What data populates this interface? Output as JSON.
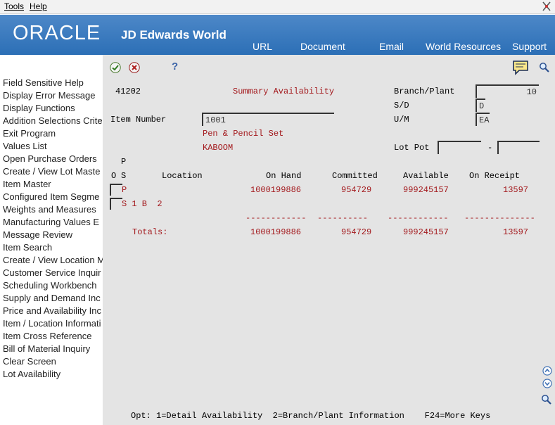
{
  "menu": {
    "tools": "Tools",
    "help": "Help"
  },
  "banner": {
    "oracle": "ORACLE",
    "product": "JD Edwards World",
    "nav": [
      "URL",
      "Document",
      "Email",
      "World Resources",
      "Support"
    ]
  },
  "sidebar": {
    "items": [
      "Field Sensitive Help",
      "Display Error Message",
      "Display Functions",
      "Addition Selections Crite",
      "Exit Program",
      "Values List",
      "Open Purchase Orders",
      "Create / View Lot Maste",
      "Item Master",
      "Configured Item Segme",
      "Weights and Measures",
      "Manufacturing Values E",
      "Message Review",
      "Item Search",
      "Create / View Location M",
      "Customer Service Inquir",
      "Scheduling Workbench",
      "Supply and Demand Inc",
      "Price and Availability Inc",
      "Item / Location Informati",
      "Item Cross Reference",
      "Bill of Material Inquiry",
      "Clear Screen",
      "Lot Availability"
    ]
  },
  "toolbar": {
    "help": "?"
  },
  "form": {
    "program_id": "41202",
    "title": "Summary Availability",
    "branch_plant_label": "Branch/Plant",
    "branch_plant_value": "10",
    "sd_label": "S/D",
    "sd_value": "D",
    "um_label": "U/M",
    "um_value": "EA",
    "item_number_label": "Item Number",
    "item_number_value": "1001",
    "item_desc1": "Pen & Pencil Set",
    "item_desc2": "KABOOM",
    "lot_pot_label": "Lot Pot",
    "lot_pot_dash": "-"
  },
  "grid": {
    "header_p": "P",
    "header_o": "O",
    "header_s": "S",
    "columns": [
      "Location",
      "On Hand",
      "Committed",
      "Available",
      "On Receipt"
    ],
    "row1": {
      "ps": "P",
      "on_hand": "1000199886",
      "committed": "954729",
      "available": "999245157",
      "on_receipt": "13597"
    },
    "row2": {
      "location": "S 1 B  2"
    },
    "separators": [
      "------------",
      "----------",
      "------------",
      "--------------"
    ],
    "totals_label": "Totals:",
    "totals": {
      "on_hand": "1000199886",
      "committed": "954729",
      "available": "999245157",
      "on_receipt": "13597"
    }
  },
  "footer": {
    "options": "Opt: 1=Detail Availability  2=Branch/Plant Information    F24=More Keys"
  }
}
